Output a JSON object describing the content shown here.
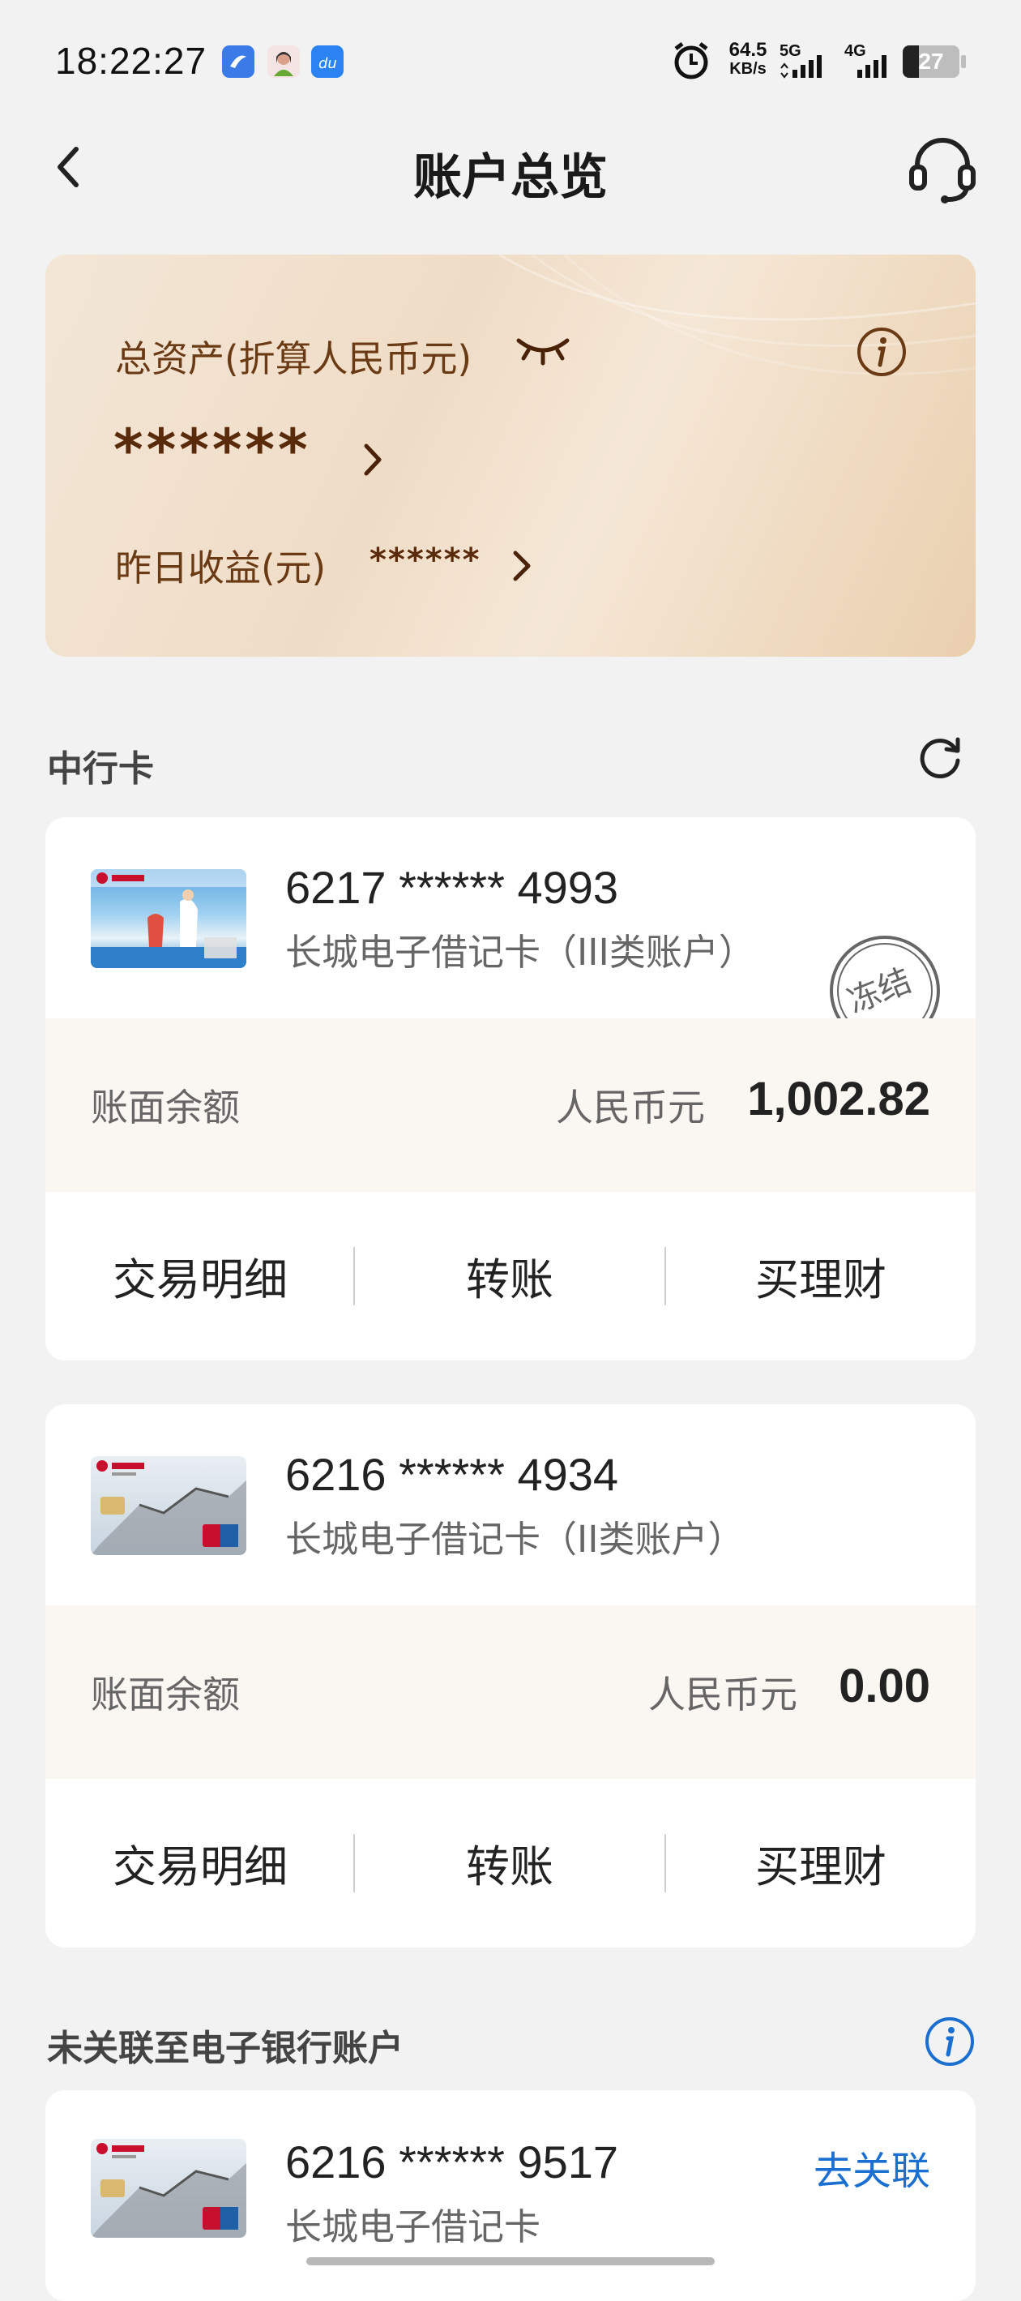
{
  "status_bar": {
    "time": "18:22:27",
    "net_speed_value": "64.5",
    "net_speed_unit": "KB/s",
    "signal1_label": "5G",
    "signal2_label": "4G",
    "battery": "27"
  },
  "header": {
    "title": "账户总览"
  },
  "assets": {
    "total_label": "总资产(折算人民币元)",
    "total_value": "******",
    "yield_label": "昨日收益(元)",
    "yield_value": "******"
  },
  "sections": {
    "boc_cards_title": "中行卡",
    "unlinked_title": "未关联至电子银行账户"
  },
  "cards": [
    {
      "number": "6217 ****** 4993",
      "type": "长城电子借记卡（III类账户）",
      "stamp": "冻结",
      "balance_label": "账面余额",
      "currency": "人民币元",
      "amount": "1,002.82",
      "actions": [
        "交易明细",
        "转账",
        "买理财"
      ]
    },
    {
      "number": "6216 ****** 4934",
      "type": "长城电子借记卡（II类账户）",
      "balance_label": "账面余额",
      "currency": "人民币元",
      "amount": "0.00",
      "actions": [
        "交易明细",
        "转账",
        "买理财"
      ]
    }
  ],
  "unlinked_cards": [
    {
      "number": "6216 ****** 9517",
      "type": "长城电子借记卡",
      "link_label": "去关联"
    }
  ],
  "colors": {
    "accent_blue": "#1a6fd0",
    "brown_text": "#6a3a14",
    "balance_bg": "#faf6f1"
  }
}
